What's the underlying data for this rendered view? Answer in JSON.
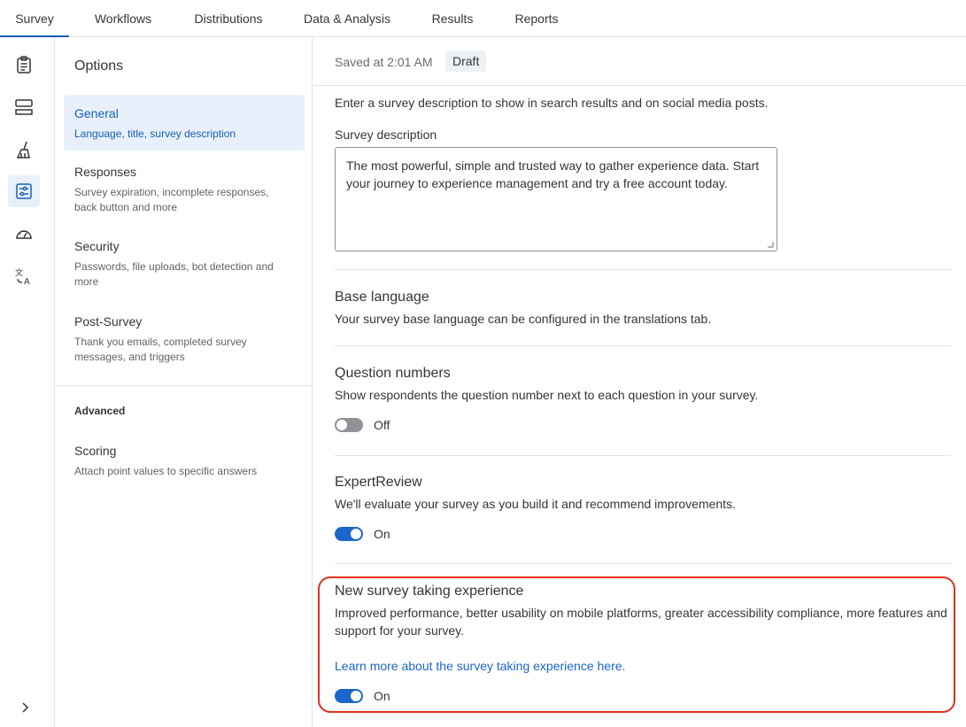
{
  "topnav": {
    "tabs": [
      "Survey",
      "Workflows",
      "Distributions",
      "Data & Analysis",
      "Results",
      "Reports"
    ],
    "active": "Survey"
  },
  "rail": {
    "icons": [
      "clipboard-icon",
      "survey-flow-icon",
      "paintbrush-icon",
      "options-sliders-icon",
      "gauge-icon",
      "translate-icon"
    ],
    "active": "options-sliders-icon",
    "expand_icon": "chevron-right-icon"
  },
  "options": {
    "title": "Options",
    "items": [
      {
        "label": "General",
        "sub": "Language, title, survey description",
        "active": true
      },
      {
        "label": "Responses",
        "sub": "Survey expiration, incomplete responses, back button and more"
      },
      {
        "label": "Security",
        "sub": "Passwords, file uploads, bot detection and more"
      },
      {
        "label": "Post-Survey",
        "sub": "Thank you emails, completed survey messages, and triggers"
      }
    ],
    "advanced_heading": "Advanced",
    "advanced_items": [
      {
        "label": "Scoring",
        "sub": "Attach point values to specific answers"
      }
    ]
  },
  "status": {
    "saved": "Saved at 2:01 AM",
    "badge": "Draft"
  },
  "main": {
    "description_help": "Enter a survey description to show in search results and on social media posts.",
    "description_label": "Survey description",
    "description_value": "The most powerful, simple and trusted way to gather experience data. Start your journey to experience management and try a free account today.",
    "base_language": {
      "title": "Base language",
      "desc": "Your survey base language can be configured in the translations tab."
    },
    "question_numbers": {
      "title": "Question numbers",
      "desc": "Show respondents the question number next to each question in your survey.",
      "state": "Off"
    },
    "expert_review": {
      "title": "ExpertReview",
      "desc": "We'll evaluate your survey as you build it and recommend improvements.",
      "state": "On"
    },
    "new_experience": {
      "title": "New survey taking experience",
      "desc": "Improved performance, better usability on mobile platforms, greater accessibility compliance, more features and support for your survey.",
      "link": "Learn more about the survey taking experience here.",
      "state": "On"
    }
  },
  "colors": {
    "accent": "#1a66c9",
    "active_bg": "#e8f0fb",
    "highlight": "#e0321f"
  }
}
